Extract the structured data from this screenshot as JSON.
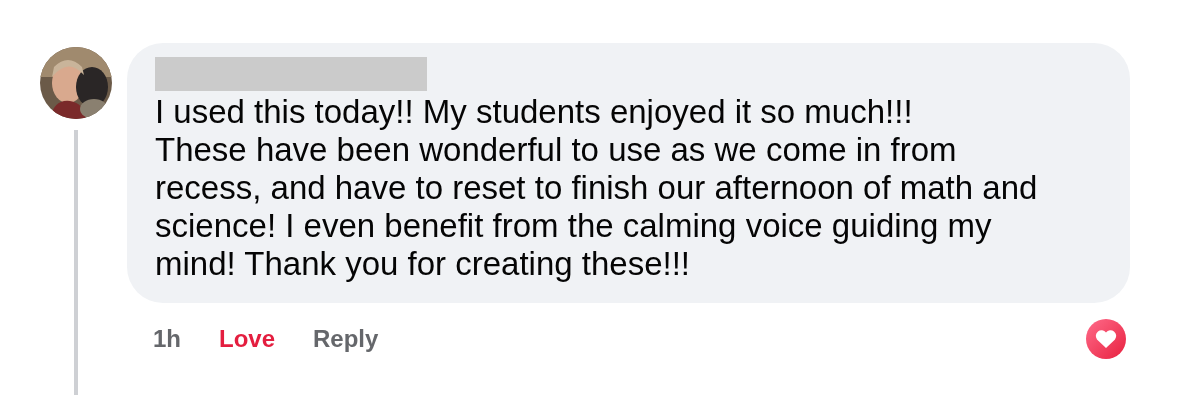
{
  "comment": {
    "author": {
      "redacted": true
    },
    "text": "I used this today!! My students enjoyed it so much!!!\nThese have been wonderful to use as we come in from recess, and have to reset to finish our afternoon of math and science! I even benefit from the calming voice guiding my mind! Thank you for creating these!!!",
    "time": "1h",
    "reaction": {
      "label": "Love",
      "selected": true
    },
    "reply": "Reply",
    "reaction_badge": {
      "kind": "love"
    }
  }
}
